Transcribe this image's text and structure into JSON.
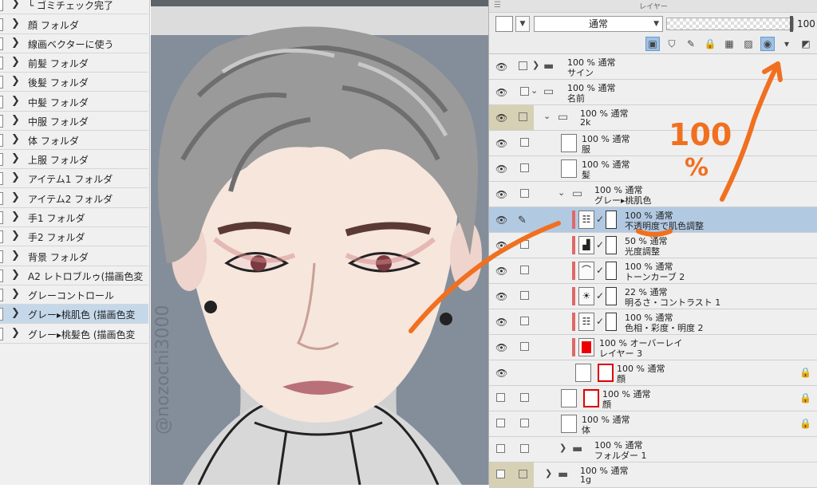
{
  "left_panel": {
    "items": [
      {
        "label": "└ ゴミチェック完了"
      },
      {
        "label": "顔 フォルダ"
      },
      {
        "label": "線画ベクターに使う"
      },
      {
        "label": "前髪 フォルダ"
      },
      {
        "label": "後髪 フォルダ"
      },
      {
        "label": "中髪 フォルダ"
      },
      {
        "label": "中服 フォルダ"
      },
      {
        "label": "体 フォルダ"
      },
      {
        "label": "上服 フォルダ"
      },
      {
        "label": "アイテム1 フォルダ"
      },
      {
        "label": "アイテム2 フォルダ"
      },
      {
        "label": "手1 フォルダ"
      },
      {
        "label": "手2 フォルダ"
      },
      {
        "label": "背景 フォルダ"
      },
      {
        "label": "A2 レトロブルゥ(描画色変"
      },
      {
        "label": "グレーコントロール"
      },
      {
        "label": "グレー▸桃肌色 (描画色変"
      },
      {
        "label": "グレー▸桃髪色 (描画色変"
      }
    ]
  },
  "canvas": {
    "watermark": "@nozochi3000"
  },
  "layer_panel": {
    "title": "レイヤー",
    "blend_mode": "通常",
    "opacity": "100",
    "layers": [
      {
        "line1": "100 % 通常",
        "line2": "サイン"
      },
      {
        "line1": "100 % 通常",
        "line2": "名前"
      },
      {
        "line1": "100 % 通常",
        "line2": "2k"
      },
      {
        "line1": "100 % 通常",
        "line2": "服"
      },
      {
        "line1": "100 % 通常",
        "line2": "髪"
      },
      {
        "line1": "100 % 通常",
        "line2": "グレー▸桃肌色"
      },
      {
        "line1": "100 % 通常",
        "line2": "不透明度で肌色調整"
      },
      {
        "line1": "50 % 通常",
        "line2": "光度調整"
      },
      {
        "line1": "100 % 通常",
        "line2": "トーンカーブ 2"
      },
      {
        "line1": "22 % 通常",
        "line2": "明るさ・コントラスト 1"
      },
      {
        "line1": "100 % 通常",
        "line2": "色相・彩度・明度 2"
      },
      {
        "line1": "100 % オーバーレイ",
        "line2": "レイヤー 3"
      },
      {
        "line1": "100 % 通常",
        "line2": "顔"
      },
      {
        "line1": "100 % 通常",
        "line2": "顔"
      },
      {
        "line1": "100 % 通常",
        "line2": "体"
      },
      {
        "line1": "100 % 通常",
        "line2": "フォルダー 1"
      },
      {
        "line1": "100 % 通常",
        "line2": "1g"
      }
    ]
  },
  "annotation": {
    "handwritten_value": "100",
    "handwritten_unit": "%",
    "ink_color": "#f07020"
  }
}
